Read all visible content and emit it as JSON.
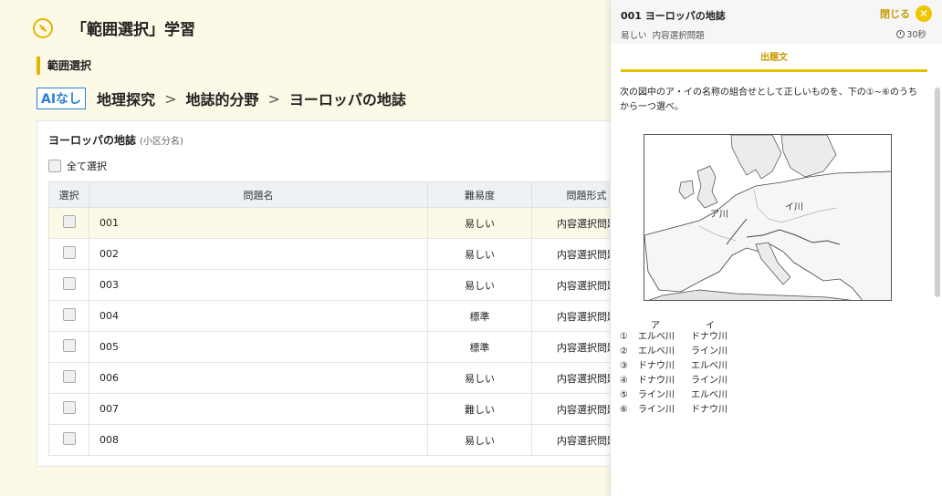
{
  "header": {
    "title": "「範囲選択」学習",
    "icon": "compass-icon"
  },
  "section_label": "範囲選択",
  "breadcrumb": {
    "badge": "AIなし",
    "items": [
      "地理探究",
      "地誌的分野",
      "ヨーロッパの地誌"
    ],
    "separator": ">"
  },
  "card": {
    "title": "ヨーロッパの地誌",
    "subtitle": "(小区分名)",
    "select_all": "全て選択",
    "columns": [
      "選択",
      "問題名",
      "難易度",
      "問題形式"
    ],
    "rows": [
      {
        "name": "001",
        "difficulty": "易しい",
        "format": "内容選択問題"
      },
      {
        "name": "002",
        "difficulty": "易しい",
        "format": "内容選択問題"
      },
      {
        "name": "003",
        "difficulty": "易しい",
        "format": "内容選択問題"
      },
      {
        "name": "004",
        "difficulty": "標準",
        "format": "内容選択問題"
      },
      {
        "name": "005",
        "difficulty": "標準",
        "format": "内容選択問題"
      },
      {
        "name": "006",
        "difficulty": "易しい",
        "format": "内容選択問題"
      },
      {
        "name": "007",
        "difficulty": "難しい",
        "format": "内容選択問題"
      },
      {
        "name": "008",
        "difficulty": "易しい",
        "format": "内容選択問題"
      }
    ]
  },
  "panel": {
    "title": "001 ヨーロッパの地誌",
    "close_label": "閉じる",
    "difficulty": "易しい",
    "format": "内容選択問題",
    "time": "30秒",
    "tab": "出題文",
    "question": "次の図中のア・イの名称の組合せとして正しいものを、下の①~⑥のうちから一つ選べ。",
    "map_labels": {
      "a": "ア川",
      "i": "イ川"
    },
    "answer_headers": {
      "a": "ア",
      "i": "イ"
    },
    "answers": [
      {
        "num": "①",
        "a": "エルベ川",
        "i": "ドナウ川"
      },
      {
        "num": "②",
        "a": "エルベ川",
        "i": "ライン川"
      },
      {
        "num": "③",
        "a": "ドナウ川",
        "i": "エルベ川"
      },
      {
        "num": "④",
        "a": "ドナウ川",
        "i": "ライン川"
      },
      {
        "num": "⑤",
        "a": "ライン川",
        "i": "エルベ川"
      },
      {
        "num": "⑥",
        "a": "ライン川",
        "i": "ドナウ川"
      }
    ]
  },
  "colors": {
    "accent": "#e3b600",
    "link": "#2a7fd4",
    "background": "#fdf9e7"
  }
}
